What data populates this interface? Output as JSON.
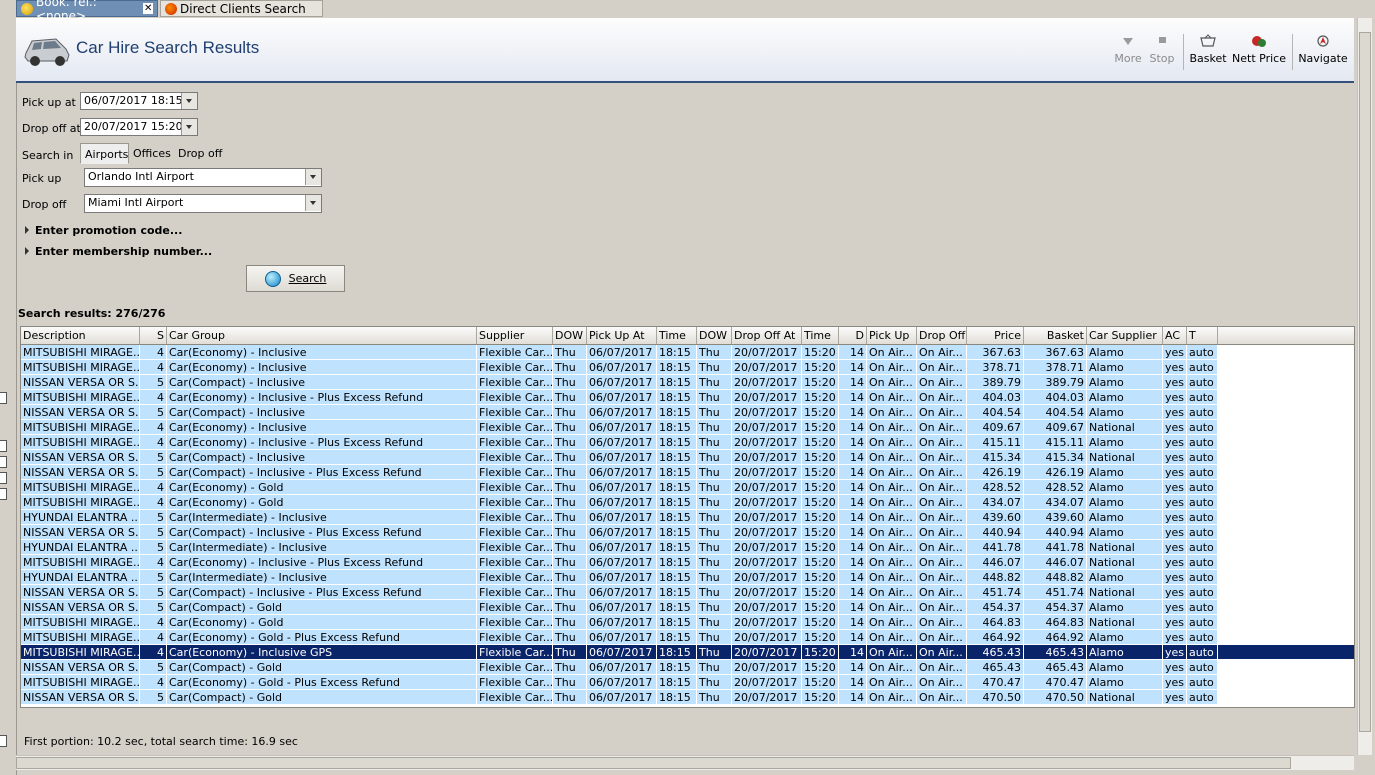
{
  "tabs": [
    {
      "label": "Book. ref.: <none>"
    },
    {
      "label": "Direct Clients Search"
    }
  ],
  "header": {
    "title": "Car Hire Search Results",
    "tools": {
      "more": "More",
      "stop": "Stop",
      "basket": "Basket",
      "nett_price": "Nett Price",
      "navigate": "Navigate"
    }
  },
  "form": {
    "pickup_at_label": "Pick up at",
    "pickup_at_value": "06/07/2017 18:15",
    "dropoff_at_label": "Drop off at",
    "dropoff_at_value": "20/07/2017 15:20",
    "search_in_label": "Search in",
    "search_in_options": [
      "Airports",
      "Offices",
      "Drop off offices"
    ],
    "search_in_selected": "Airports",
    "pickup_label": "Pick up",
    "pickup_value": "Orlando Intl Airport",
    "dropoff_label": "Drop off",
    "dropoff_value": "Miami Intl Airport",
    "promo_label": "Enter promotion code...",
    "membership_label": "Enter membership number...",
    "search_button": "Search"
  },
  "results_count": "Search results: 276/276",
  "grid": {
    "columns": [
      "Description",
      "S",
      "Car Group",
      "Supplier",
      "DOW",
      "Pick Up At",
      "Time",
      "DOW",
      "Drop Off At",
      "Time",
      "D",
      "Pick Up",
      "Drop Off",
      "Price",
      "Basket",
      "Car Supplier",
      "AC",
      "T"
    ],
    "rows": [
      [
        "MITSUBISHI MIRAGE...",
        "4",
        "Car(Economy) - Inclusive",
        "Flexible Car...",
        "Thu",
        "06/07/2017",
        "18:15",
        "Thu",
        "20/07/2017",
        "15:20",
        "14",
        "On Air...",
        "On Air...",
        "367.63",
        "367.63",
        "Alamo",
        "yes",
        "auto"
      ],
      [
        "MITSUBISHI MIRAGE...",
        "4",
        "Car(Economy) - Inclusive",
        "Flexible Car...",
        "Thu",
        "06/07/2017",
        "18:15",
        "Thu",
        "20/07/2017",
        "15:20",
        "14",
        "On Air...",
        "On Air...",
        "378.71",
        "378.71",
        "Alamo",
        "yes",
        "auto"
      ],
      [
        "NISSAN VERSA OR S...",
        "5",
        "Car(Compact) - Inclusive",
        "Flexible Car...",
        "Thu",
        "06/07/2017",
        "18:15",
        "Thu",
        "20/07/2017",
        "15:20",
        "14",
        "On Air...",
        "On Air...",
        "389.79",
        "389.79",
        "Alamo",
        "yes",
        "auto"
      ],
      [
        "MITSUBISHI MIRAGE...",
        "4",
        "Car(Economy) - Inclusive - Plus Excess Refund",
        "Flexible Car...",
        "Thu",
        "06/07/2017",
        "18:15",
        "Thu",
        "20/07/2017",
        "15:20",
        "14",
        "On Air...",
        "On Air...",
        "404.03",
        "404.03",
        "Alamo",
        "yes",
        "auto"
      ],
      [
        "NISSAN VERSA OR S...",
        "5",
        "Car(Compact) - Inclusive",
        "Flexible Car...",
        "Thu",
        "06/07/2017",
        "18:15",
        "Thu",
        "20/07/2017",
        "15:20",
        "14",
        "On Air...",
        "On Air...",
        "404.54",
        "404.54",
        "Alamo",
        "yes",
        "auto"
      ],
      [
        "MITSUBISHI MIRAGE...",
        "4",
        "Car(Economy) - Inclusive",
        "Flexible Car...",
        "Thu",
        "06/07/2017",
        "18:15",
        "Thu",
        "20/07/2017",
        "15:20",
        "14",
        "On Air...",
        "On Air...",
        "409.67",
        "409.67",
        "National",
        "yes",
        "auto"
      ],
      [
        "MITSUBISHI MIRAGE...",
        "4",
        "Car(Economy) - Inclusive - Plus Excess Refund",
        "Flexible Car...",
        "Thu",
        "06/07/2017",
        "18:15",
        "Thu",
        "20/07/2017",
        "15:20",
        "14",
        "On Air...",
        "On Air...",
        "415.11",
        "415.11",
        "Alamo",
        "yes",
        "auto"
      ],
      [
        "NISSAN VERSA OR S...",
        "5",
        "Car(Compact) - Inclusive",
        "Flexible Car...",
        "Thu",
        "06/07/2017",
        "18:15",
        "Thu",
        "20/07/2017",
        "15:20",
        "14",
        "On Air...",
        "On Air...",
        "415.34",
        "415.34",
        "National",
        "yes",
        "auto"
      ],
      [
        "NISSAN VERSA OR S...",
        "5",
        "Car(Compact) - Inclusive - Plus Excess Refund",
        "Flexible Car...",
        "Thu",
        "06/07/2017",
        "18:15",
        "Thu",
        "20/07/2017",
        "15:20",
        "14",
        "On Air...",
        "On Air...",
        "426.19",
        "426.19",
        "Alamo",
        "yes",
        "auto"
      ],
      [
        "MITSUBISHI MIRAGE...",
        "4",
        "Car(Economy) - Gold",
        "Flexible Car...",
        "Thu",
        "06/07/2017",
        "18:15",
        "Thu",
        "20/07/2017",
        "15:20",
        "14",
        "On Air...",
        "On Air...",
        "428.52",
        "428.52",
        "Alamo",
        "yes",
        "auto"
      ],
      [
        "MITSUBISHI MIRAGE...",
        "4",
        "Car(Economy) - Gold",
        "Flexible Car...",
        "Thu",
        "06/07/2017",
        "18:15",
        "Thu",
        "20/07/2017",
        "15:20",
        "14",
        "On Air...",
        "On Air...",
        "434.07",
        "434.07",
        "Alamo",
        "yes",
        "auto"
      ],
      [
        "HYUNDAI ELANTRA ...",
        "5",
        "Car(Intermediate) - Inclusive",
        "Flexible Car...",
        "Thu",
        "06/07/2017",
        "18:15",
        "Thu",
        "20/07/2017",
        "15:20",
        "14",
        "On Air...",
        "On Air...",
        "439.60",
        "439.60",
        "Alamo",
        "yes",
        "auto"
      ],
      [
        "NISSAN VERSA OR S...",
        "5",
        "Car(Compact) - Inclusive - Plus Excess Refund",
        "Flexible Car...",
        "Thu",
        "06/07/2017",
        "18:15",
        "Thu",
        "20/07/2017",
        "15:20",
        "14",
        "On Air...",
        "On Air...",
        "440.94",
        "440.94",
        "Alamo",
        "yes",
        "auto"
      ],
      [
        "HYUNDAI ELANTRA ...",
        "5",
        "Car(Intermediate) - Inclusive",
        "Flexible Car...",
        "Thu",
        "06/07/2017",
        "18:15",
        "Thu",
        "20/07/2017",
        "15:20",
        "14",
        "On Air...",
        "On Air...",
        "441.78",
        "441.78",
        "National",
        "yes",
        "auto"
      ],
      [
        "MITSUBISHI MIRAGE...",
        "4",
        "Car(Economy) - Inclusive - Plus Excess Refund",
        "Flexible Car...",
        "Thu",
        "06/07/2017",
        "18:15",
        "Thu",
        "20/07/2017",
        "15:20",
        "14",
        "On Air...",
        "On Air...",
        "446.07",
        "446.07",
        "National",
        "yes",
        "auto"
      ],
      [
        "HYUNDAI ELANTRA ...",
        "5",
        "Car(Intermediate) - Inclusive",
        "Flexible Car...",
        "Thu",
        "06/07/2017",
        "18:15",
        "Thu",
        "20/07/2017",
        "15:20",
        "14",
        "On Air...",
        "On Air...",
        "448.82",
        "448.82",
        "Alamo",
        "yes",
        "auto"
      ],
      [
        "NISSAN VERSA OR S...",
        "5",
        "Car(Compact) - Inclusive - Plus Excess Refund",
        "Flexible Car...",
        "Thu",
        "06/07/2017",
        "18:15",
        "Thu",
        "20/07/2017",
        "15:20",
        "14",
        "On Air...",
        "On Air...",
        "451.74",
        "451.74",
        "National",
        "yes",
        "auto"
      ],
      [
        "NISSAN VERSA OR S...",
        "5",
        "Car(Compact) - Gold",
        "Flexible Car...",
        "Thu",
        "06/07/2017",
        "18:15",
        "Thu",
        "20/07/2017",
        "15:20",
        "14",
        "On Air...",
        "On Air...",
        "454.37",
        "454.37",
        "Alamo",
        "yes",
        "auto"
      ],
      [
        "MITSUBISHI MIRAGE...",
        "4",
        "Car(Economy) - Gold",
        "Flexible Car...",
        "Thu",
        "06/07/2017",
        "18:15",
        "Thu",
        "20/07/2017",
        "15:20",
        "14",
        "On Air...",
        "On Air...",
        "464.83",
        "464.83",
        "National",
        "yes",
        "auto"
      ],
      [
        "MITSUBISHI MIRAGE...",
        "4",
        "Car(Economy) - Gold - Plus Excess Refund",
        "Flexible Car...",
        "Thu",
        "06/07/2017",
        "18:15",
        "Thu",
        "20/07/2017",
        "15:20",
        "14",
        "On Air...",
        "On Air...",
        "464.92",
        "464.92",
        "Alamo",
        "yes",
        "auto"
      ],
      [
        "MITSUBISHI MIRAGE...",
        "4",
        "Car(Economy) - Inclusive GPS",
        "Flexible Car...",
        "Thu",
        "06/07/2017",
        "18:15",
        "Thu",
        "20/07/2017",
        "15:20",
        "14",
        "On Air...",
        "On Air...",
        "465.43",
        "465.43",
        "Alamo",
        "yes",
        "auto"
      ],
      [
        "NISSAN VERSA OR S...",
        "5",
        "Car(Compact) - Gold",
        "Flexible Car...",
        "Thu",
        "06/07/2017",
        "18:15",
        "Thu",
        "20/07/2017",
        "15:20",
        "14",
        "On Air...",
        "On Air...",
        "465.43",
        "465.43",
        "Alamo",
        "yes",
        "auto"
      ],
      [
        "MITSUBISHI MIRAGE...",
        "4",
        "Car(Economy) - Gold - Plus Excess Refund",
        "Flexible Car...",
        "Thu",
        "06/07/2017",
        "18:15",
        "Thu",
        "20/07/2017",
        "15:20",
        "14",
        "On Air...",
        "On Air...",
        "470.47",
        "470.47",
        "Alamo",
        "yes",
        "auto"
      ],
      [
        "NISSAN VERSA OR S...",
        "5",
        "Car(Compact) - Gold",
        "Flexible Car...",
        "Thu",
        "06/07/2017",
        "18:15",
        "Thu",
        "20/07/2017",
        "15:20",
        "14",
        "On Air...",
        "On Air...",
        "470.50",
        "470.50",
        "National",
        "yes",
        "auto"
      ]
    ],
    "selected_row": 20
  },
  "status_text": "First portion: 10.2 sec, total search time: 16.9 sec",
  "colors": {
    "row_bg": "#bfe3ff",
    "selected_bg": "#0a246a",
    "title": "#1f3f6e"
  }
}
